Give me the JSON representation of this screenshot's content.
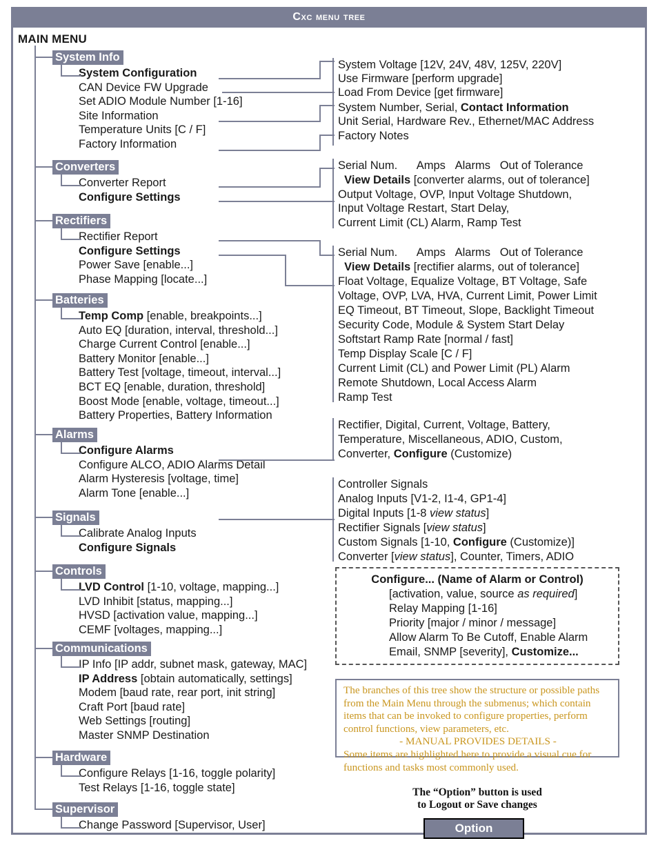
{
  "header": {
    "title": "CXC Menu Tree"
  },
  "root_label": "MAIN MENU",
  "colors": {
    "accent": "#7b7f95",
    "note_text": "#c9961f",
    "text": "#1a1a1a"
  },
  "tree": {
    "groups": [
      {
        "name": "System Info",
        "items": [
          {
            "text": "System Configuration",
            "bold": true
          },
          {
            "text": "CAN Device FW Upgrade",
            "bold": false
          },
          {
            "text": "Set ADIO Module Number [1-16]",
            "bold": false
          },
          {
            "text": "Site Information",
            "bold": false
          },
          {
            "text": "Temperature Units [C / F]",
            "bold": false
          },
          {
            "text": "Factory Information",
            "bold": false
          }
        ]
      },
      {
        "name": "Converters",
        "items": [
          {
            "text": "Converter Report",
            "bold": false
          },
          {
            "text": "Configure Settings",
            "bold": true
          }
        ]
      },
      {
        "name": "Rectifiers",
        "items": [
          {
            "text": "Rectifier Report",
            "bold": false
          },
          {
            "text": "Configure Settings",
            "bold": true
          },
          {
            "text": "Power Save [enable...]",
            "bold": false
          },
          {
            "text": "Phase Mapping [locate...]",
            "bold": false
          }
        ]
      },
      {
        "name": "Batteries",
        "items": [
          {
            "text": "Temp Comp",
            "suffix": " [enable, breakpoints...]",
            "bold": true
          },
          {
            "text": "Auto EQ [duration, interval, threshold...]",
            "bold": false
          },
          {
            "text": "Charge Current Control [enable...]",
            "bold": false
          },
          {
            "text": "Battery Monitor [enable...]",
            "bold": false
          },
          {
            "text": "Battery Test [voltage, timeout, interval...]",
            "bold": false
          },
          {
            "text": "BCT EQ [enable, duration, threshold]",
            "bold": false
          },
          {
            "text": "Boost Mode [enable, voltage, timeout...]",
            "bold": false
          },
          {
            "text": "Battery Properties, Battery Information",
            "bold": false
          }
        ]
      },
      {
        "name": "Alarms",
        "items": [
          {
            "text": "Configure Alarms",
            "bold": true
          },
          {
            "text": "Configure ALCO, ADIO Alarms Detail",
            "bold": false
          },
          {
            "text": "Alarm Hysteresis [voltage, time]",
            "bold": false
          },
          {
            "text": "Alarm Tone [enable...]",
            "bold": false
          }
        ]
      },
      {
        "name": "Signals",
        "items": [
          {
            "text": "Calibrate Analog Inputs",
            "bold": false
          },
          {
            "text": "Configure Signals",
            "bold": true
          }
        ]
      },
      {
        "name": "Controls",
        "items": [
          {
            "text": "LVD Control",
            "suffix": " [1-10, voltage, mapping...]",
            "bold": true
          },
          {
            "text": "LVD Inhibit [status, mapping...]",
            "bold": false
          },
          {
            "text": "HVSD [activation value, mapping...]",
            "bold": false
          },
          {
            "text": "CEMF [voltages, mapping...]",
            "bold": false
          }
        ]
      },
      {
        "name": "Communications",
        "items": [
          {
            "text": "IP Info [IP addr, subnet mask, gateway, MAC]",
            "bold": false
          },
          {
            "text": "IP Address",
            "suffix": " [obtain automatically, settings]",
            "bold": true
          },
          {
            "text": "Modem [baud rate, rear port, init string]",
            "bold": false
          },
          {
            "text": "Craft Port [baud rate]",
            "bold": false
          },
          {
            "text": "Web Settings [routing]",
            "bold": false
          },
          {
            "text": "Master SNMP Destination",
            "bold": false
          }
        ]
      },
      {
        "name": "Hardware",
        "items": [
          {
            "text": "Configure Relays [1-16, toggle polarity]",
            "bold": false
          },
          {
            "text": "Test Relays [1-16, toggle state]",
            "bold": false
          }
        ]
      },
      {
        "name": "Supervisor",
        "items": [
          {
            "text": "Change Password [Supervisor, User]",
            "bold": false
          }
        ]
      }
    ]
  },
  "detail_blocks": {
    "system_info": [
      "System Voltage [12V, 24V, 48V, 125V, 220V]",
      "Use Firmware [perform upgrade]",
      "Load From Device [get firmware]",
      "System Number, Serial, <b>Contact Information</b>",
      "Unit Serial, Hardware Rev., Ethernet/MAC Address",
      "Factory Notes"
    ],
    "converters": [
      "Serial Num.&nbsp;&nbsp;&nbsp;&nbsp;&nbsp;&nbsp;Amps&nbsp;&nbsp;&nbsp;Alarms&nbsp;&nbsp;&nbsp;Out of Tolerance",
      "&nbsp;&nbsp;<b>View Details</b> [converter alarms, out of tolerance]",
      "Output Voltage, OVP, Input Voltage Shutdown,",
      "Input Voltage Restart, Start Delay,",
      "Current Limit (CL) Alarm, Ramp Test"
    ],
    "rectifiers": [
      "Serial Num.&nbsp;&nbsp;&nbsp;&nbsp;&nbsp;&nbsp;Amps&nbsp;&nbsp;&nbsp;Alarms&nbsp;&nbsp;&nbsp;Out of Tolerance",
      "&nbsp;&nbsp;<b>View Details</b> [rectifier alarms, out of tolerance]",
      "Float Voltage, Equalize Voltage, BT Voltage, Safe",
      "Voltage, OVP, LVA, HVA, Current Limit, Power Limit",
      "EQ Timeout, BT Timeout, Slope, Backlight Timeout",
      "Security Code, Module &amp; System Start Delay",
      "Softstart Ramp Rate [normal / fast]",
      "Temp Display Scale [C / F]",
      "Current Limit (CL) and Power Limit (PL) Alarm",
      "Remote Shutdown, Local Access Alarm",
      "Ramp Test"
    ],
    "alarms": [
      "Rectifier, Digital, Current, Voltage, Battery,",
      "Temperature, Miscellaneous, ADIO, Custom,",
      "Converter, <b>Configure</b> (Customize)"
    ],
    "signals": [
      "Controller Signals",
      "Analog Inputs [V1-2, I1-4, GP1-4]",
      "Digital Inputs [1-8 <i>view status</i>]",
      "Rectifier Signals [<i>view status</i>]",
      "Custom Signals [1-10, <b>Configure</b> (Customize)]",
      "Converter [<i>view status</i>], Counter, Timers, ADIO"
    ]
  },
  "configure_box": {
    "title": "Configure... (Name of Alarm or Control)",
    "lines": [
      "[activation, value, source <i>as required</i>]",
      "Relay Mapping [1-16]",
      "Priority [major / minor / message]",
      "Allow Alarm To Be Cutoff, Enable Alarm",
      "Email, SNMP [severity], <b>Customize...</b>"
    ]
  },
  "note_box": {
    "lines": [
      "The branches of this tree show the structure or possible paths",
      "from the Main Menu through the submenus; which contain",
      "items that can be invoked to configure properties, perform",
      "control functions, view parameters, etc."
    ],
    "center_line": "- MANUAL PROVIDES DETAILS -",
    "lines2": [
      "Some items are highlighted here to provide a visual cue for",
      "functions and tasks most commonly used."
    ]
  },
  "footer": {
    "caption_line1": "The “Option” button is used",
    "caption_line2": "to Logout or Save changes",
    "button_label": "Option"
  }
}
